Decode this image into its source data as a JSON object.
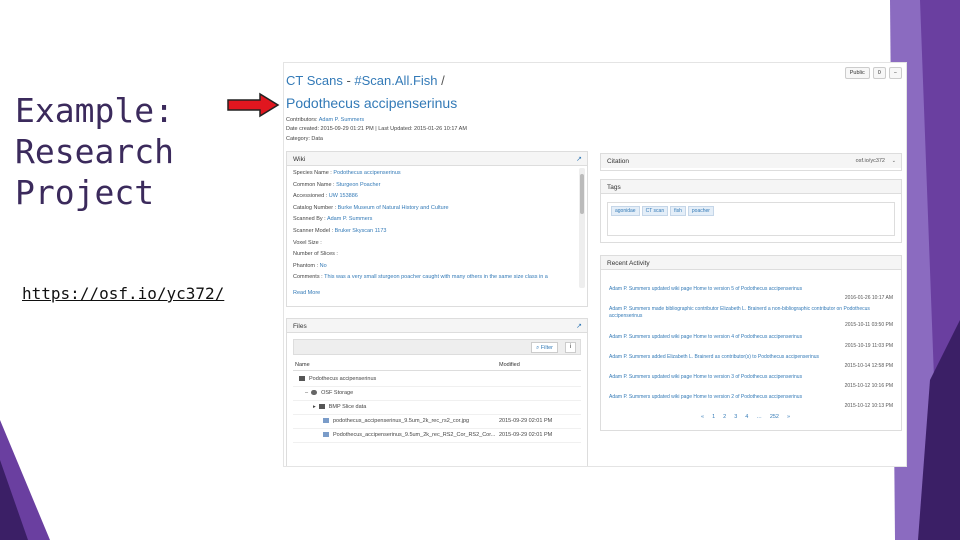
{
  "slide": {
    "title_lines": [
      "Example:",
      "Research",
      "Project"
    ],
    "link": "https://osf.io/yc372/"
  },
  "colors": {
    "purple_dark": "#3b1f66",
    "purple_mid": "#6a3fa0",
    "purple_light": "#8b6bc0",
    "arrow_red": "#e0161f",
    "link_blue": "#337ab7"
  },
  "osf": {
    "breadcrumb": {
      "part1": "CT Scans",
      "sep1": " - ",
      "part2": "#Scan.All.Fish",
      "sep2": " /"
    },
    "project_title": "Podothecus accipenserinus",
    "contributors_label": "Contributors:",
    "contributors_value": "Adam P. Summers",
    "dates": "Date created: 2015-09-29 01:21 PM | Last Updated: 2015-01-26 10:17 AM",
    "category": "Category: Data",
    "top_buttons": [
      "Public",
      "0",
      "−"
    ],
    "wiki": {
      "header": "Wiki",
      "rows": [
        {
          "label": "Species Name : ",
          "value": "Podothecus accipenserinus"
        },
        {
          "label": "Common Name : ",
          "value": "Sturgeon Poacher"
        },
        {
          "label": "Accessioned : ",
          "value": "UW 153886"
        },
        {
          "label": "Catalog Number : ",
          "value": "Burke Museum of Natural History and Culture"
        },
        {
          "label": "Scanned By : ",
          "value": "Adam P. Summers"
        },
        {
          "label": "Scanner Model : ",
          "value": "Bruker Skyscan 1173"
        },
        {
          "label": "Voxel Size : ",
          "value": ""
        },
        {
          "label": "Number of Slices : ",
          "value": ""
        },
        {
          "label": "Phantom : ",
          "value": "No"
        },
        {
          "label": "Comments : ",
          "value": "This was a very small sturgeon poacher caught with many others in the same size class in a"
        }
      ],
      "read_more": "Read More"
    },
    "files": {
      "header": "Files",
      "filter_label": "Filter",
      "info_icon": "i",
      "col_name": "Name",
      "col_modified": "Modified",
      "rows": [
        {
          "name": "Podothecus accipenserinus",
          "modified": ""
        },
        {
          "name": "OSF Storage",
          "modified": ""
        },
        {
          "name": "BMP Slice data",
          "modified": ""
        },
        {
          "name": "podothecus_accipenserinus_9.5um_2k_rec_rs2_cor.jpg",
          "modified": "2015-09-29 02:01 PM"
        },
        {
          "name": "Podothecus_accipenserinus_9.5um_2k_rec_RS2_Cor_RS2_Cor...",
          "modified": "2015-09-29 02:01 PM"
        }
      ]
    },
    "citation": {
      "header": "Citation",
      "value": "osf.io/yc372"
    },
    "tags": {
      "header": "Tags",
      "items": [
        "agonidae",
        "CT scan",
        "fish",
        "poacher"
      ]
    },
    "activity": {
      "header": "Recent Activity",
      "items": [
        {
          "text": "Adam P. Summers updated wiki page Home to version 5 of Podothecus accipenserinus",
          "time": "2016-01-26 10:17 AM"
        },
        {
          "text": "Adam P. Summers made bibliographic contributor Elizabeth L. Brainerd a non-bibliographic contributor on Podothecus accipenserinus",
          "time": "2015-10-11 03:50 PM"
        },
        {
          "text": "Adam P. Summers updated wiki page Home to version 4 of Podothecus accipenserinus",
          "time": "2015-10-19 11:03 PM"
        },
        {
          "text": "Adam P. Summers added Elizabeth L. Brainerd as contributor(s) to Podothecus accipenserinus",
          "time": "2015-10-14 12:58 PM"
        },
        {
          "text": "Adam P. Summers updated wiki page Home to version 3 of Podothecus accipenserinus",
          "time": "2015-10-12 10:16 PM"
        },
        {
          "text": "Adam P. Summers updated wiki page Home to version 2 of Podothecus accipenserinus",
          "time": "2015-10-12 10:13 PM"
        }
      ],
      "pagination": [
        "«",
        "1",
        "2",
        "3",
        "4",
        "…",
        "252",
        "»"
      ]
    }
  }
}
